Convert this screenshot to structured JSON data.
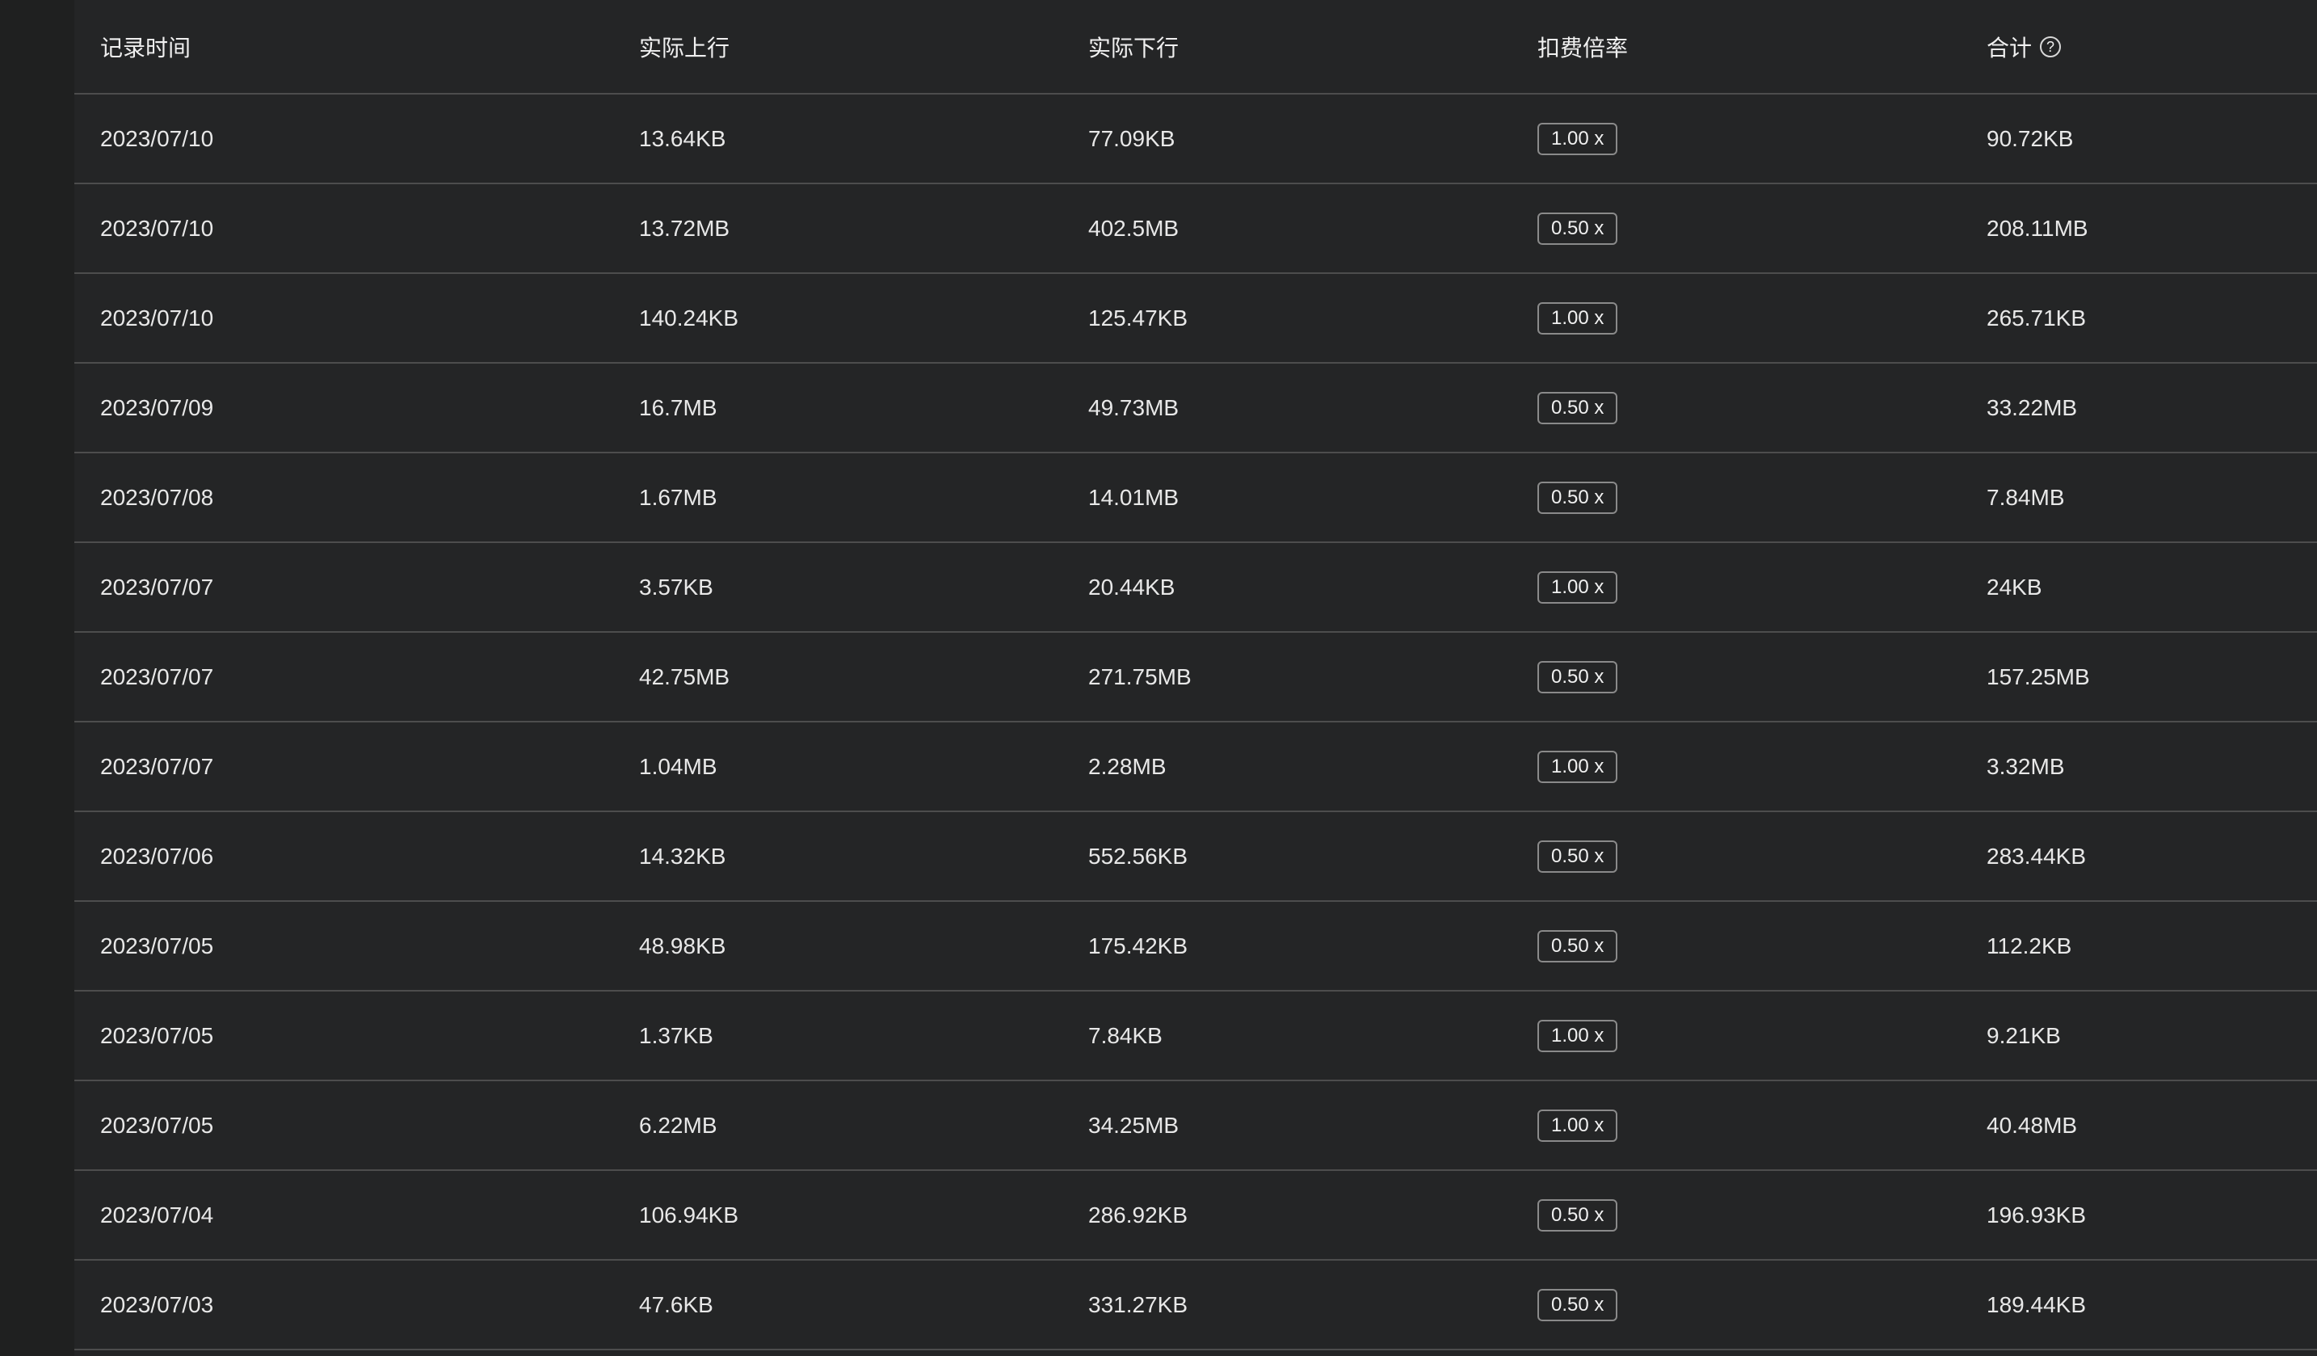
{
  "columns": {
    "time": "记录时间",
    "upload": "实际上行",
    "download": "实际下行",
    "rate": "扣费倍率",
    "total": "合计"
  },
  "rows": [
    {
      "time": "2023/07/10",
      "upload": "13.64KB",
      "download": "77.09KB",
      "rate": "1.00 x",
      "total": "90.72KB"
    },
    {
      "time": "2023/07/10",
      "upload": "13.72MB",
      "download": "402.5MB",
      "rate": "0.50 x",
      "total": "208.11MB"
    },
    {
      "time": "2023/07/10",
      "upload": "140.24KB",
      "download": "125.47KB",
      "rate": "1.00 x",
      "total": "265.71KB"
    },
    {
      "time": "2023/07/09",
      "upload": "16.7MB",
      "download": "49.73MB",
      "rate": "0.50 x",
      "total": "33.22MB"
    },
    {
      "time": "2023/07/08",
      "upload": "1.67MB",
      "download": "14.01MB",
      "rate": "0.50 x",
      "total": "7.84MB"
    },
    {
      "time": "2023/07/07",
      "upload": "3.57KB",
      "download": "20.44KB",
      "rate": "1.00 x",
      "total": "24KB"
    },
    {
      "time": "2023/07/07",
      "upload": "42.75MB",
      "download": "271.75MB",
      "rate": "0.50 x",
      "total": "157.25MB"
    },
    {
      "time": "2023/07/07",
      "upload": "1.04MB",
      "download": "2.28MB",
      "rate": "1.00 x",
      "total": "3.32MB"
    },
    {
      "time": "2023/07/06",
      "upload": "14.32KB",
      "download": "552.56KB",
      "rate": "0.50 x",
      "total": "283.44KB"
    },
    {
      "time": "2023/07/05",
      "upload": "48.98KB",
      "download": "175.42KB",
      "rate": "0.50 x",
      "total": "112.2KB"
    },
    {
      "time": "2023/07/05",
      "upload": "1.37KB",
      "download": "7.84KB",
      "rate": "1.00 x",
      "total": "9.21KB"
    },
    {
      "time": "2023/07/05",
      "upload": "6.22MB",
      "download": "34.25MB",
      "rate": "1.00 x",
      "total": "40.48MB"
    },
    {
      "time": "2023/07/04",
      "upload": "106.94KB",
      "download": "286.92KB",
      "rate": "0.50 x",
      "total": "196.93KB"
    },
    {
      "time": "2023/07/03",
      "upload": "47.6KB",
      "download": "331.27KB",
      "rate": "0.50 x",
      "total": "189.44KB"
    }
  ],
  "icons": {
    "total_help": "question-circle-icon"
  }
}
